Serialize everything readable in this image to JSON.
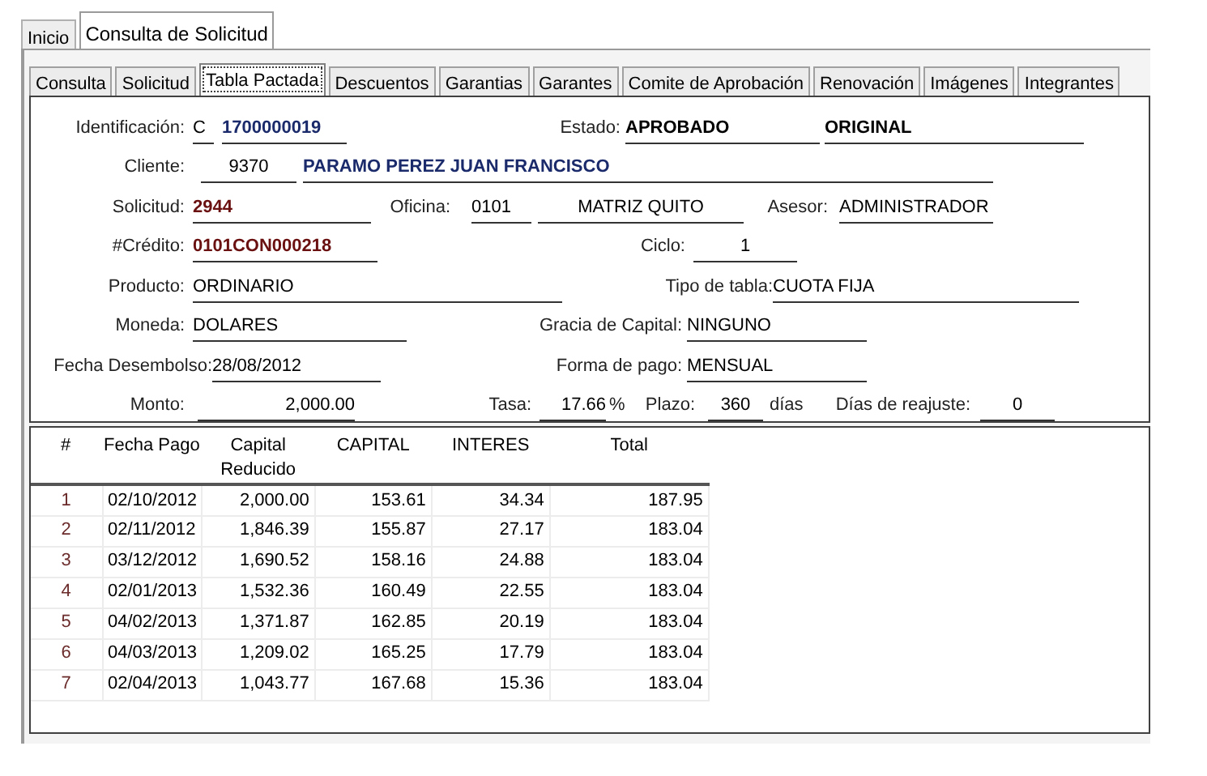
{
  "tabs": [
    {
      "label": "Inicio",
      "selected": false
    },
    {
      "label": "Consulta de Solicitud",
      "selected": true
    }
  ],
  "subtabs": [
    {
      "label": "Consulta",
      "selected": false
    },
    {
      "label": "Solicitud",
      "selected": false
    },
    {
      "label": "Tabla Pactada",
      "selected": true
    },
    {
      "label": "Descuentos",
      "selected": false
    },
    {
      "label": "Garantias",
      "selected": false
    },
    {
      "label": "Garantes",
      "selected": false
    },
    {
      "label": "Comite de Aprobación",
      "selected": false
    },
    {
      "label": "Renovación",
      "selected": false
    },
    {
      "label": "Imágenes",
      "selected": false
    },
    {
      "label": "Integrantes",
      "selected": false
    }
  ],
  "form": {
    "fields": [
      {
        "label": "Identificación:",
        "values": [
          {
            "kind": "plain",
            "text": "C"
          },
          {
            "kind": "key",
            "text": "1700000019"
          }
        ]
      },
      {
        "label": "Estado:",
        "values": [
          {
            "kind": "status",
            "text": "APROBADO"
          },
          {
            "kind": "status",
            "text": "ORIGINAL"
          }
        ]
      },
      {
        "label": "Cliente:",
        "values": [
          {
            "kind": "plain",
            "text": "9370"
          },
          {
            "kind": "key",
            "text": "PARAMO PEREZ JUAN FRANCISCO"
          }
        ]
      },
      {
        "label": "Solicitud:",
        "values": [
          {
            "kind": "ref",
            "text": "2944"
          }
        ]
      },
      {
        "label": "Oficina:",
        "values": [
          {
            "kind": "plain",
            "text": "0101"
          },
          {
            "kind": "plain",
            "text": "MATRIZ QUITO"
          }
        ]
      },
      {
        "label": "Asesor:",
        "values": [
          {
            "kind": "plain",
            "text": "ADMINISTRADOR"
          }
        ]
      },
      {
        "label": "#Crédito:",
        "values": [
          {
            "kind": "ref",
            "text": "0101CON000218"
          }
        ]
      },
      {
        "label": "Ciclo:",
        "values": [
          {
            "kind": "plain",
            "text": "1"
          }
        ]
      },
      {
        "label": "Producto:",
        "values": [
          {
            "kind": "plain",
            "text": "ORDINARIO"
          }
        ]
      },
      {
        "label": "Tipo de tabla:",
        "values": [
          {
            "kind": "plain",
            "text": "CUOTA FIJA"
          }
        ]
      },
      {
        "label": "Moneda:",
        "values": [
          {
            "kind": "plain",
            "text": "DOLARES"
          }
        ]
      },
      {
        "label": "Gracia de Capital:",
        "values": [
          {
            "kind": "plain",
            "text": "NINGUNO"
          }
        ]
      },
      {
        "label": "Fecha Desembolso:",
        "values": [
          {
            "kind": "plain",
            "text": "28/08/2012"
          }
        ]
      },
      {
        "label": "Forma de pago:",
        "values": [
          {
            "kind": "plain",
            "text": "MENSUAL"
          }
        ]
      },
      {
        "label": "Monto:",
        "values": [
          {
            "kind": "plain",
            "text": "2,000.00"
          }
        ]
      },
      {
        "label": "Tasa:",
        "values": [
          {
            "kind": "plain",
            "text": "17.66"
          },
          {
            "kind": "unit",
            "text": "%"
          }
        ]
      },
      {
        "label": "Plazo:",
        "values": [
          {
            "kind": "plain",
            "text": "360"
          },
          {
            "kind": "unit",
            "text": "días"
          }
        ]
      },
      {
        "label": "Días de reajuste:",
        "values": [
          {
            "kind": "plain",
            "text": "0"
          }
        ]
      }
    ]
  },
  "schedule": {
    "columns": [
      "#",
      "Fecha Pago",
      "Capital Reducido",
      "CAPITAL",
      "INTERES",
      "Total"
    ],
    "rows": [
      [
        "1",
        "02/10/2012",
        "2,000.00",
        "153.61",
        "34.34",
        "187.95"
      ],
      [
        "2",
        "02/11/2012",
        "1,846.39",
        "155.87",
        "27.17",
        "183.04"
      ],
      [
        "3",
        "03/12/2012",
        "1,690.52",
        "158.16",
        "24.88",
        "183.04"
      ],
      [
        "4",
        "02/01/2013",
        "1,532.36",
        "160.49",
        "22.55",
        "183.04"
      ],
      [
        "5",
        "04/02/2013",
        "1,371.87",
        "162.85",
        "20.19",
        "183.04"
      ],
      [
        "6",
        "04/03/2013",
        "1,209.02",
        "165.25",
        "17.79",
        "183.04"
      ],
      [
        "7",
        "02/04/2013",
        "1,043.77",
        "167.68",
        "15.36",
        "183.04"
      ]
    ]
  }
}
